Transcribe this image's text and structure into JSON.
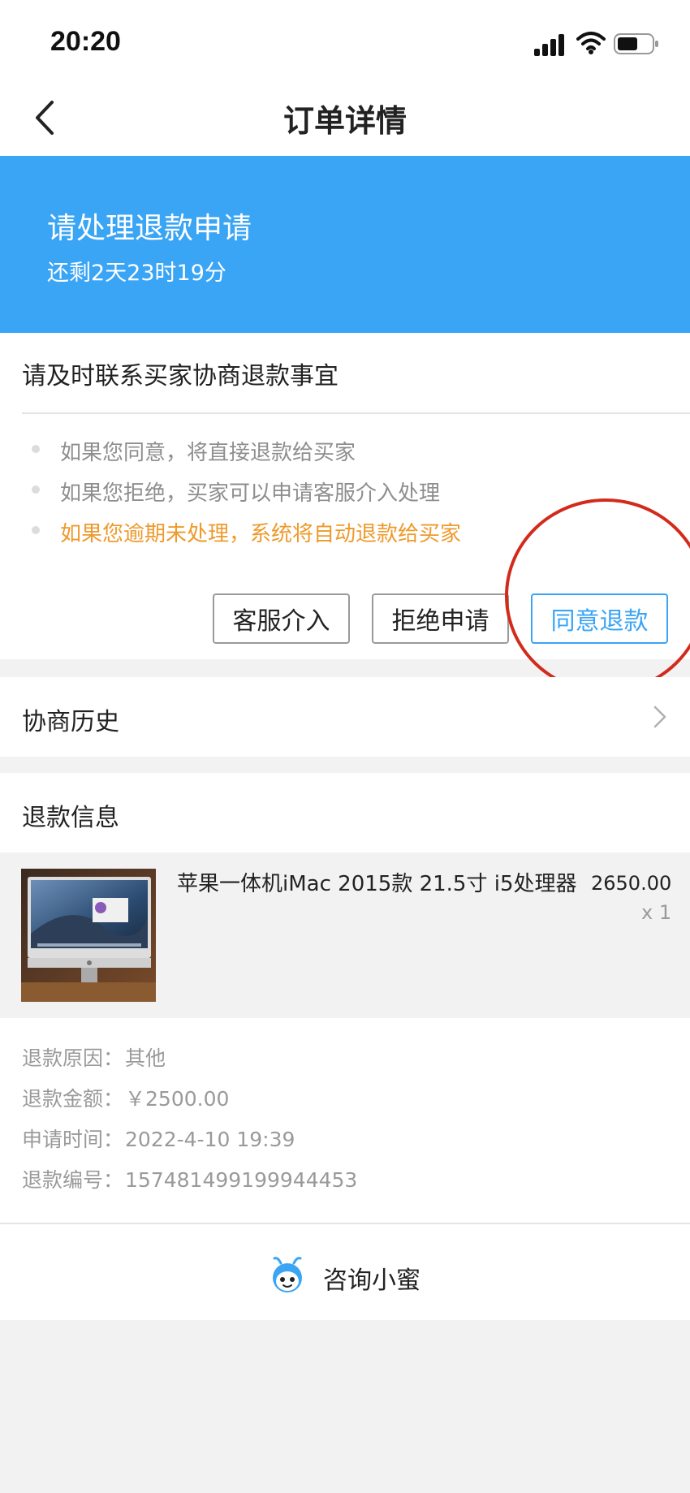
{
  "status_bar": {
    "time": "20:20"
  },
  "nav": {
    "title": "订单详情"
  },
  "banner": {
    "title": "请处理退款申请",
    "countdown": "还剩2天23时19分",
    "color": "#3aa4f5"
  },
  "action_card": {
    "title": "请及时联系买家协商退款事宜",
    "tips": [
      "如果您同意，将直接退款给买家",
      "如果您拒绝，买家可以申请客服介入处理",
      "如果您逾期未处理，系统将自动退款给买家"
    ],
    "warn_color": "#ee9a2b",
    "buttons": {
      "service": "客服介入",
      "reject": "拒绝申请",
      "agree": "同意退款"
    }
  },
  "history": {
    "label": "协商历史"
  },
  "refund": {
    "title": "退款信息",
    "product": {
      "name": "苹果一体机iMac 2015款 21.5寸 i5处理器",
      "price": "2650.00",
      "qty": "x 1"
    },
    "details": [
      {
        "label": "退款原因：",
        "value": "其他"
      },
      {
        "label": "退款金额：",
        "value": "￥2500.00"
      },
      {
        "label": "申请时间：",
        "value": "2022-4-10 19:39"
      },
      {
        "label": "退款编号：",
        "value": "157481499199944453"
      }
    ]
  },
  "consult": {
    "label": "咨询小蜜"
  }
}
